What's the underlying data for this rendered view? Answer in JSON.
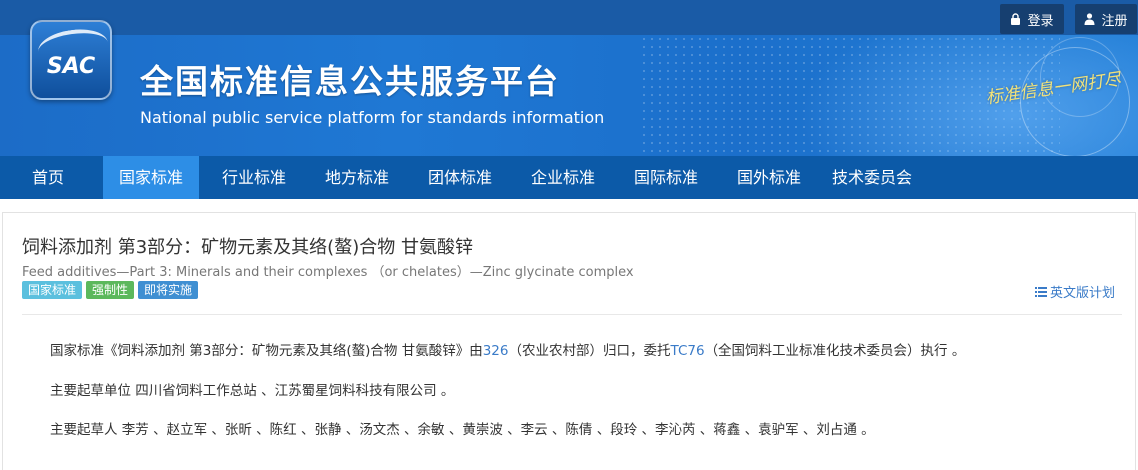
{
  "header": {
    "login_label": "登录",
    "register_label": "注册",
    "logo_text": "SAC",
    "site_title": "全国标准信息公共服务平台",
    "site_subtitle": "National public service platform  for standards information",
    "slogan": "标准信息一网打尽"
  },
  "nav": {
    "items": [
      {
        "label": "首页",
        "active": false
      },
      {
        "label": "国家标准",
        "active": true
      },
      {
        "label": "行业标准",
        "active": false
      },
      {
        "label": "地方标准",
        "active": false
      },
      {
        "label": "团体标准",
        "active": false
      },
      {
        "label": "企业标准",
        "active": false
      },
      {
        "label": "国际标准",
        "active": false
      },
      {
        "label": "国外标准",
        "active": false
      },
      {
        "label": "技术委员会",
        "active": false
      }
    ]
  },
  "standard": {
    "title": "饲料添加剂 第3部分：矿物元素及其络(螯)合物 甘氨酸锌",
    "title_en": "Feed additives—Part 3: Minerals and their complexes （or chelates）—Zinc glycinate complex",
    "badges": [
      "国家标准",
      "强制性",
      "即将实施"
    ],
    "en_plan_label": "英文版计划",
    "p1_prefix": "国家标准《饲料添加剂 第3部分：矿物元素及其络(螯)合物 甘氨酸锌》由",
    "p1_dept_code": "326",
    "p1_middle": "（农业农村部）归口，委托",
    "p1_tc_code": "TC76",
    "p1_suffix": "（全国饲料工业标准化技术委员会）执行 。",
    "drafting_units": "主要起草单位 四川省饲料工作总站 、江苏蜀星饲料科技有限公司 。",
    "drafters": "主要起草人 李芳 、赵立军 、张昕 、陈红 、张静 、汤文杰 、余敏 、黄崇波 、李云 、陈倩 、段玲 、李沁芮 、蒋鑫 、袁驴军 、刘占通 。"
  },
  "colors": {
    "top_bar": "#1a5ba6",
    "nav_bg": "#0c5aa8",
    "nav_active": "#2d8ee6",
    "link": "#3a7bc8",
    "badge_national": "#5bc0de",
    "badge_mandatory": "#5cb85c",
    "badge_upcoming": "#3f8fd2"
  }
}
